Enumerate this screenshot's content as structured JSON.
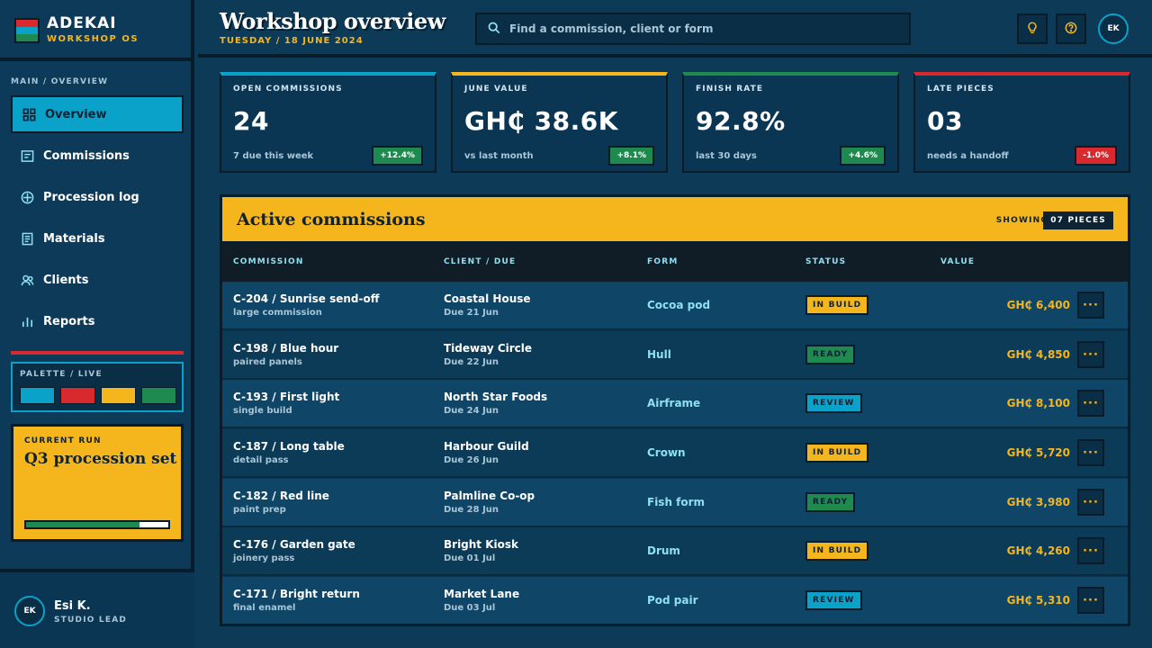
{
  "brand": {
    "name": "ADEKAI",
    "subtitle": "WORKSHOP OS"
  },
  "colors": {
    "navy": "#0d3a57",
    "cyan": "#0aa2c9",
    "red": "#d8292f",
    "yellow": "#f5b51d",
    "green": "#1e8a4f",
    "ink": "#091c2a"
  },
  "sidebar": {
    "section_label": "MAIN / OVERVIEW",
    "items": [
      {
        "label": "Overview",
        "icon": "grid-icon",
        "active": true
      },
      {
        "label": "Commissions",
        "icon": "list-icon",
        "active": false
      },
      {
        "label": "Procession log",
        "icon": "compass-icon",
        "active": false
      },
      {
        "label": "Materials",
        "icon": "document-icon",
        "active": false
      },
      {
        "label": "Clients",
        "icon": "users-icon",
        "active": false
      },
      {
        "label": "Reports",
        "icon": "bar-chart-icon",
        "active": false
      }
    ],
    "palette": {
      "title": "PALETTE / LIVE",
      "swatches": [
        "#0aa2c9",
        "#d8292f",
        "#f5b51d",
        "#1e8a4f"
      ]
    },
    "current_run": {
      "label": "CURRENT RUN",
      "title": "Q3 procession set",
      "progress": 0.8
    },
    "user": {
      "initials": "EK",
      "name": "Esi K.",
      "role": "STUDIO LEAD"
    }
  },
  "header": {
    "title": "Workshop overview",
    "date": "TUESDAY / 18 JUNE 2024",
    "search_placeholder": "Find a commission, client or form",
    "actions": [
      {
        "name": "lightbulb-icon"
      },
      {
        "name": "help-icon"
      }
    ],
    "avatar_initials": "EK"
  },
  "kpis": [
    {
      "label": "OPEN COMMISSIONS",
      "value": "24",
      "sub": "7 due this week",
      "delta": "+12.4%",
      "accent": "#0aa2c9",
      "delta_color": "#1e8a4f"
    },
    {
      "label": "JUNE VALUE",
      "value": "GH₵ 38.6K",
      "sub": "vs last month",
      "delta": "+8.1%",
      "accent": "#f5b51d",
      "delta_color": "#1e8a4f"
    },
    {
      "label": "FINISH RATE",
      "value": "92.8%",
      "sub": "last 30 days",
      "delta": "+4.6%",
      "accent": "#1e8a4f",
      "delta_color": "#1e8a4f"
    },
    {
      "label": "LATE PIECES",
      "value": "03",
      "sub": "needs a handoff",
      "delta": "-1.0%",
      "accent": "#d8292f",
      "delta_color": "#d8292f"
    }
  ],
  "table": {
    "title": "Active commissions",
    "showing_label": "SHOWING",
    "showing_value": "07 PIECES",
    "columns": [
      "COMMISSION",
      "CLIENT / DUE",
      "FORM",
      "STATUS",
      "VALUE"
    ],
    "more_label": "···",
    "rows": [
      {
        "title": "C-204 / Sunrise send-off",
        "note": "large commission",
        "client": "Coastal House",
        "due": "Due 21 Jun",
        "form": "Cocoa pod",
        "status": "IN BUILD",
        "status_color": "#f5b51d",
        "value": "GH₵ 6,400"
      },
      {
        "title": "C-198 / Blue hour",
        "note": "paired panels",
        "client": "Tideway Circle",
        "due": "Due 22 Jun",
        "form": "Hull",
        "status": "READY",
        "status_color": "#1e8a4f",
        "value": "GH₵ 4,850"
      },
      {
        "title": "C-193 / First light",
        "note": "single build",
        "client": "North Star Foods",
        "due": "Due 24 Jun",
        "form": "Airframe",
        "status": "REVIEW",
        "status_color": "#0aa2c9",
        "value": "GH₵ 8,100"
      },
      {
        "title": "C-187 / Long table",
        "note": "detail pass",
        "client": "Harbour Guild",
        "due": "Due 26 Jun",
        "form": "Crown",
        "status": "IN BUILD",
        "status_color": "#f5b51d",
        "value": "GH₵ 5,720"
      },
      {
        "title": "C-182 / Red line",
        "note": "paint prep",
        "client": "Palmline Co-op",
        "due": "Due 28 Jun",
        "form": "Fish form",
        "status": "READY",
        "status_color": "#1e8a4f",
        "value": "GH₵ 3,980"
      },
      {
        "title": "C-176 / Garden gate",
        "note": "joinery pass",
        "client": "Bright Kiosk",
        "due": "Due 01 Jul",
        "form": "Drum",
        "status": "IN BUILD",
        "status_color": "#f5b51d",
        "value": "GH₵ 4,260"
      },
      {
        "title": "C-171 / Bright return",
        "note": "final enamel",
        "client": "Market Lane",
        "due": "Due 03 Jul",
        "form": "Pod pair",
        "status": "REVIEW",
        "status_color": "#0aa2c9",
        "value": "GH₵ 5,310"
      }
    ]
  }
}
